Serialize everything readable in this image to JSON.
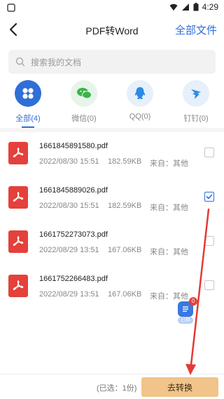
{
  "status_bar": {
    "time": "4:29"
  },
  "nav": {
    "title": "PDF转Word",
    "right_action": "全部文件"
  },
  "search": {
    "placeholder": "搜索我的文档"
  },
  "filters": [
    {
      "label": "全部(4)",
      "icon": "grid-icon",
      "active": true
    },
    {
      "label": "微信(0)",
      "icon": "wechat-icon",
      "active": false
    },
    {
      "label": "QQ(0)",
      "icon": "qq-icon",
      "active": false
    },
    {
      "label": "钉钉(0)",
      "icon": "dingtalk-icon",
      "active": false
    }
  ],
  "files": [
    {
      "name": "1661845891580.pdf",
      "date": "2022/08/30 15:51",
      "size": "182.59KB",
      "source": "来自：其他",
      "checked": false
    },
    {
      "name": "1661845889026.pdf",
      "date": "2022/08/30 15:51",
      "size": "182.59KB",
      "source": "来自：其他",
      "checked": true
    },
    {
      "name": "1661752273073.pdf",
      "date": "2022/08/29 13:51",
      "size": "167.06KB",
      "source": "来自：其他",
      "checked": false
    },
    {
      "name": "1661752266483.pdf",
      "date": "2022/08/29 13:51",
      "size": "167.06KB",
      "source": "来自：其他",
      "checked": false
    }
  ],
  "floating": {
    "count": "0",
    "tag": "已转"
  },
  "bottom": {
    "selected_text": "(已选：1份)",
    "convert_label": "去转换"
  },
  "colors": {
    "accent": "#2f6fd7",
    "pdf_red": "#e5403b",
    "convert_bg": "#f0c48a",
    "annotation_red": "#e53935"
  }
}
